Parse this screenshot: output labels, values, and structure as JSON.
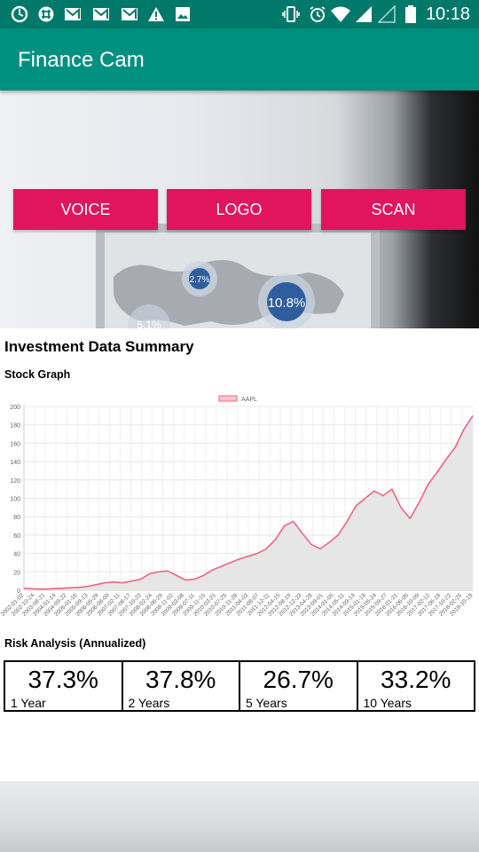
{
  "status_bar": {
    "time": "10:18",
    "left_icons": [
      "sync-icon",
      "slack-icon",
      "gmail-icon",
      "gmail-icon",
      "gmail-icon",
      "warning-icon",
      "image-icon"
    ],
    "right_icons": [
      "vibrate-icon",
      "alarm-icon",
      "wifi-icon",
      "cell-signal-icon",
      "cell-signal-empty-icon",
      "battery-icon"
    ]
  },
  "app_bar": {
    "title": "Finance Cam",
    "color": "#009080"
  },
  "hero": {
    "buttons": {
      "voice": "VOICE",
      "logo": "LOGO",
      "scan": "SCAN"
    },
    "button_color": "#e0155e",
    "map_bubbles": {
      "small": "2.7%",
      "large": "10.8%",
      "partial": "5.1%"
    }
  },
  "summary": {
    "title": "Investment Data Summary",
    "stock_graph_label": "Stock Graph",
    "risk_label": "Risk Analysis (Annualized)"
  },
  "chart_data": {
    "type": "area",
    "legend": [
      "AAPL"
    ],
    "ylim": [
      0,
      200
    ],
    "yticks": [
      0,
      20,
      40,
      60,
      80,
      100,
      120,
      140,
      160,
      180,
      200
    ],
    "x_tick_labels": [
      "2002-01-02",
      "2002-10-24",
      "2003-08-21",
      "2004-01-14",
      "2004-09-22",
      "2005-01-16",
      "2005-09-13",
      "2006-05-29",
      "2006-08-09",
      "2007-02-11",
      "2007-06-17",
      "2007-10-23",
      "2008-02-24",
      "2008-06-29",
      "2008-11-02",
      "2009-03-08",
      "2009-07-11",
      "2009-11-15",
      "2010-03-21",
      "2010-07-25",
      "2010-11-28",
      "2011-04-03",
      "2011-08-07",
      "2011-12-11",
      "2012-04-15",
      "2012-08-19",
      "2012-12-23",
      "2013-04-28",
      "2013-09-01",
      "2014-01-05",
      "2014-05-11",
      "2014-09-14",
      "2015-01-18",
      "2015-05-24",
      "2015-09-27",
      "2016-01-31",
      "2016-06-05",
      "2016-10-09",
      "2017-02-12",
      "2017-06-18",
      "2017-10-22",
      "2018-02-25",
      "2018-10-18"
    ],
    "series": [
      {
        "name": "AAPL",
        "color": "#f0657f",
        "fill": "#e6e6e6",
        "x": [
          0,
          2,
          4,
          6,
          8,
          10,
          12,
          14,
          16,
          18,
          20,
          22,
          24,
          26,
          28,
          30,
          32,
          34,
          36,
          38,
          40,
          42,
          44,
          46,
          48,
          50,
          52,
          54,
          56,
          58,
          60,
          62,
          64,
          66,
          68,
          70,
          72,
          74,
          76,
          78,
          80,
          82,
          84,
          86,
          88,
          90,
          92,
          94,
          96,
          98,
          100
        ],
        "values": [
          2,
          1.5,
          1.2,
          1.5,
          2,
          2.5,
          3,
          4,
          6,
          8,
          9,
          8,
          10,
          12,
          18,
          20,
          21,
          16,
          11,
          12,
          16,
          22,
          26,
          30,
          34,
          37,
          40,
          45,
          55,
          70,
          75,
          62,
          50,
          45,
          52,
          60,
          75,
          92,
          100,
          108,
          103,
          110,
          90,
          78,
          95,
          115,
          128,
          142,
          155,
          175,
          190
        ]
      }
    ]
  },
  "risk": [
    {
      "pct": "37.3%",
      "period": "1 Year"
    },
    {
      "pct": "37.8%",
      "period": "2 Years"
    },
    {
      "pct": "26.7%",
      "period": "5 Years"
    },
    {
      "pct": "33.2%",
      "period": "10 Years"
    }
  ]
}
